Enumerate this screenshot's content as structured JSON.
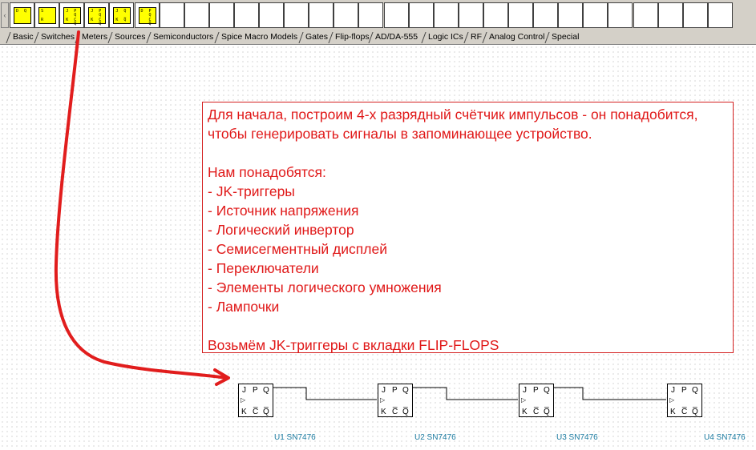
{
  "toolbar": {
    "scroll_left_icon": "chevron-left-icon",
    "components": [
      {
        "name": "d-flipflop",
        "pins": [
          "D",
          "Q",
          "",
          ""
        ]
      },
      {
        "name": "sr-flipflop",
        "pins": [
          "S",
          "",
          "R",
          ""
        ]
      },
      {
        "name": "jk-flipflop-selected",
        "pins": [
          "J",
          "P Q",
          "K",
          "C Q̅"
        ]
      },
      {
        "name": "jk-flipflop-2",
        "pins": [
          "J",
          "P Q",
          "K",
          "C Q̅"
        ]
      },
      {
        "name": "jk-flipflop-3",
        "pins": [
          "J",
          "Q",
          "K",
          "Q̅"
        ]
      },
      {
        "name": "d-flipflop-2",
        "pins": [
          "D",
          "P Q",
          "",
          "C Q̅"
        ]
      }
    ]
  },
  "tabs": [
    {
      "label": "Basic"
    },
    {
      "label": "Switches"
    },
    {
      "label": "Meters"
    },
    {
      "label": "Sources"
    },
    {
      "label": "Semiconductors"
    },
    {
      "label": "Spice Macro Models"
    },
    {
      "label": "Gates"
    },
    {
      "label": "Flip-flops",
      "active": true
    },
    {
      "label": "AD/DA-555"
    },
    {
      "label": "Logic ICs"
    },
    {
      "label": "RF"
    },
    {
      "label": "Analog Control"
    },
    {
      "label": "Special"
    }
  ],
  "note": {
    "lines": [
      "Для начала, построим 4-х разрядный счётчик импульсов - он понадобится,",
      "чтобы генерировать сигналы в запоминающее устройство.",
      "",
      "Нам понадобятся:",
      "- JK-триггеры",
      "- Источник напряжения",
      "- Логический инвертор",
      "- Семисегментный дисплей",
      "- Переключатели",
      "- Элементы логического умножения",
      "- Лампочки",
      "",
      "Возьмём JK-триггеры с вкладки FLIP-FLOPS"
    ]
  },
  "flipflops": [
    {
      "label": "U1 SN7476"
    },
    {
      "label": "U2 SN7476"
    },
    {
      "label": "U3 SN7476"
    },
    {
      "label": "U4 SN7476"
    }
  ],
  "pins": {
    "j": "J",
    "p": "P",
    "q": "Q",
    "k": "K",
    "c": "C̅",
    "qbar": "Q̅"
  },
  "colors": {
    "annotation_red": "#e01818",
    "label_blue": "#1a7aa0",
    "chip_yellow": "#ffff00"
  }
}
